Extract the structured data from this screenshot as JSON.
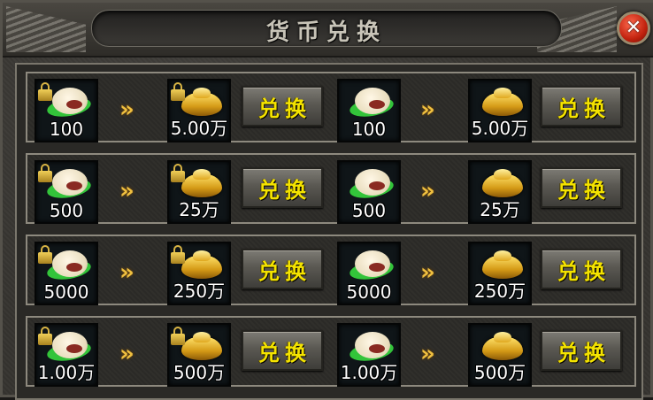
{
  "window": {
    "title": "货币兑换",
    "close_label": "✕"
  },
  "rows": [
    {
      "left": {
        "from": "100",
        "to": "5.00万",
        "button": "兑换"
      },
      "right": {
        "from": "100",
        "to": "5.00万",
        "button": "兑换"
      }
    },
    {
      "left": {
        "from": "500",
        "to": "25万",
        "button": "兑换"
      },
      "right": {
        "from": "500",
        "to": "25万",
        "button": "兑换"
      }
    },
    {
      "left": {
        "from": "5000",
        "to": "250万",
        "button": "兑换"
      },
      "right": {
        "from": "5000",
        "to": "250万",
        "button": "兑换"
      }
    },
    {
      "left": {
        "from": "1.00万",
        "to": "500万",
        "button": "兑换"
      },
      "right": {
        "from": "1.00万",
        "to": "500万",
        "button": "兑换"
      }
    }
  ],
  "arrow_glyph": "»",
  "colors": {
    "button_text": "#f4e300",
    "arrow": "#f0c040",
    "close": "#c1220e"
  },
  "icons": {
    "from_currency": "steamed-bun-icon",
    "to_currency": "gold-ingot-icon",
    "bound_marker": "lock-icon"
  }
}
